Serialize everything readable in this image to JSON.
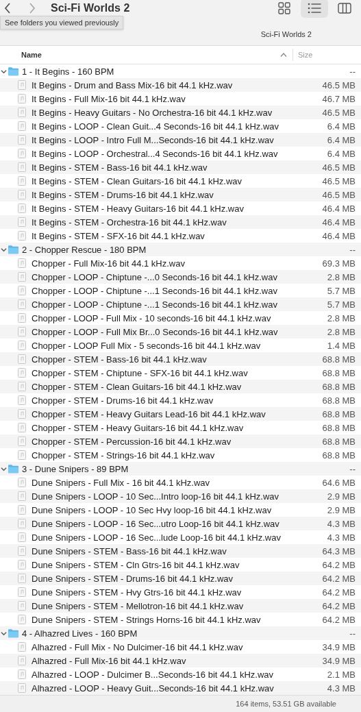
{
  "window": {
    "title": "Sci-Fi Worlds 2",
    "tooltip": "See folders you viewed previously",
    "path": "Sci-Fi Worlds 2"
  },
  "view_buttons": [
    {
      "kind": "icons",
      "selected": false
    },
    {
      "kind": "list",
      "selected": true
    },
    {
      "kind": "columns",
      "selected": false
    }
  ],
  "columns": [
    {
      "label": "Name",
      "sorted": true
    },
    {
      "label": "Size",
      "sorted": false
    }
  ],
  "items": [
    {
      "name": "1 - It Begins - 160 BPM",
      "size": "--",
      "expanded": true,
      "children": [
        {
          "name": "It Begins - Drum and Bass Mix-16 bit 44.1 kHz.wav",
          "size": "46.5 MB"
        },
        {
          "name": "It Begins - Full Mix-16 bit 44.1 kHz.wav",
          "size": "46.7 MB"
        },
        {
          "name": "It Begins - Heavy Guitars - No Orchestra-16 bit 44.1 kHz.wav",
          "size": "46.5 MB"
        },
        {
          "name": "It Begins - LOOP - Clean Guit...4 Seconds-16 bit 44.1 kHz.wav",
          "size": "6.4 MB"
        },
        {
          "name": "It Begins - LOOP - Intro Full M...Seconds-16 bit 44.1 kHz.wav",
          "size": "6.4 MB"
        },
        {
          "name": "It Begins - LOOP - Orchestral...4 Seconds-16 bit 44.1 kHz.wav",
          "size": "6.4 MB"
        },
        {
          "name": "It Begins - STEM - Bass-16 bit 44.1 kHz.wav",
          "size": "46.5 MB"
        },
        {
          "name": "It Begins - STEM - Clean Guitars-16 bit 44.1 kHz.wav",
          "size": "46.5 MB"
        },
        {
          "name": "It Begins - STEM - Drums-16 bit 44.1 kHz.wav",
          "size": "46.5 MB"
        },
        {
          "name": "It Begins - STEM - Heavy Guitars-16 bit 44.1 kHz.wav",
          "size": "46.4 MB"
        },
        {
          "name": "It Begins - STEM - Orchestra-16 bit 44.1 kHz.wav",
          "size": "46.4 MB"
        },
        {
          "name": "It Begins - STEM - SFX-16 bit 44.1 kHz.wav",
          "size": "46.4 MB"
        }
      ]
    },
    {
      "name": "2 - Chopper Rescue - 180 BPM",
      "size": "--",
      "expanded": true,
      "children": [
        {
          "name": "Chopper - Full Mix-16 bit 44.1 kHz.wav",
          "size": "69.3 MB"
        },
        {
          "name": "Chopper - LOOP - Chiptune -...0 Seconds-16 bit 44.1 kHz.wav",
          "size": "2.8 MB"
        },
        {
          "name": "Chopper - LOOP - Chiptune -...1 Seconds-16 bit 44.1 kHz.wav",
          "size": "5.7 MB"
        },
        {
          "name": "Chopper - LOOP - Chiptune -...1 Seconds-16 bit 44.1 kHz.wav",
          "size": "5.7 MB"
        },
        {
          "name": "Chopper - LOOP - Full Mix - 10 seconds-16 bit 44.1 kHz.wav",
          "size": "2.8 MB"
        },
        {
          "name": "Chopper - LOOP - Full Mix Br...0 Seconds-16 bit 44.1 kHz.wav",
          "size": "2.8 MB"
        },
        {
          "name": "Chopper - LOOP Full Mix - 5 seconds-16 bit 44.1 kHz.wav",
          "size": "1.4 MB"
        },
        {
          "name": "Chopper - STEM - Bass-16 bit 44.1 kHz.wav",
          "size": "68.8 MB"
        },
        {
          "name": "Chopper - STEM - Chiptune - SFX-16 bit 44.1 kHz.wav",
          "size": "68.8 MB"
        },
        {
          "name": "Chopper - STEM - Clean Guitars-16 bit 44.1 kHz.wav",
          "size": "68.8 MB"
        },
        {
          "name": "Chopper - STEM - Drums-16 bit 44.1 kHz.wav",
          "size": "68.8 MB"
        },
        {
          "name": "Chopper - STEM - Heavy Guitars Lead-16 bit 44.1 kHz.wav",
          "size": "68.8 MB"
        },
        {
          "name": "Chopper - STEM - Heavy Guitars-16 bit 44.1 kHz.wav",
          "size": "68.8 MB"
        },
        {
          "name": "Chopper - STEM - Percussion-16 bit 44.1 kHz.wav",
          "size": "68.8 MB"
        },
        {
          "name": "Chopper - STEM - Strings-16 bit 44.1 kHz.wav",
          "size": "68.8 MB"
        }
      ]
    },
    {
      "name": "3 - Dune Snipers - 89 BPM",
      "size": "--",
      "expanded": true,
      "children": [
        {
          "name": "Dune Snipers - Full Mix - 16 bit 44.1 kHz.wav",
          "size": "64.6 MB"
        },
        {
          "name": "Dune Snipers - LOOP - 10 Sec...Intro loop-16 bit 44.1 kHz.wav",
          "size": "2.9 MB"
        },
        {
          "name": "Dune Snipers - LOOP - 10 Sec Hvy loop-16 bit 44.1 kHz.wav",
          "size": "2.9 MB"
        },
        {
          "name": "Dune Snipers - LOOP - 16 Sec...utro Loop-16 bit 44.1 kHz.wav",
          "size": "4.3 MB"
        },
        {
          "name": "Dune Snipers - LOOP - 16 Sec...lude Loop-16 bit 44.1 kHz.wav",
          "size": "4.3 MB"
        },
        {
          "name": "Dune Snipers - STEM - Bass-16 bit 44.1 kHz.wav",
          "size": "64.3 MB"
        },
        {
          "name": "Dune Snipers - STEM - Cln Gtrs-16 bit 44.1 kHz.wav",
          "size": "64.2 MB"
        },
        {
          "name": "Dune Snipers - STEM - Drums-16 bit 44.1 kHz.wav",
          "size": "64.2 MB"
        },
        {
          "name": "Dune Snipers - STEM - Hvy Gtrs-16 bit 44.1 kHz.wav",
          "size": "64.2 MB"
        },
        {
          "name": "Dune Snipers - STEM - Mellotron-16 bit 44.1 kHz.wav",
          "size": "64.2 MB"
        },
        {
          "name": "Dune Snipers - STEM - Strings Horns-16 bit 44.1 kHz.wav",
          "size": "64.2 MB"
        }
      ]
    },
    {
      "name": "4 - Alhazred Lives - 160 BPM",
      "size": "--",
      "expanded": true,
      "children": [
        {
          "name": "Alhazred - Full Mix - No Dulcimer-16 bit 44.1 kHz.wav",
          "size": "34.9 MB"
        },
        {
          "name": "Alhazred - Full Mix-16 bit 44.1 kHz.wav",
          "size": "34.9 MB"
        },
        {
          "name": "Alhazred - LOOP - Dulcimer B...Seconds-16 bit 44.1 kHz.wav",
          "size": "2.1 MB"
        },
        {
          "name": "Alhazred - LOOP - Heavy Guit...Seconds-16 bit 44.1 kHz.wav",
          "size": "4.3 MB"
        }
      ]
    }
  ],
  "status_bar": "164 items, 53.51 GB available"
}
